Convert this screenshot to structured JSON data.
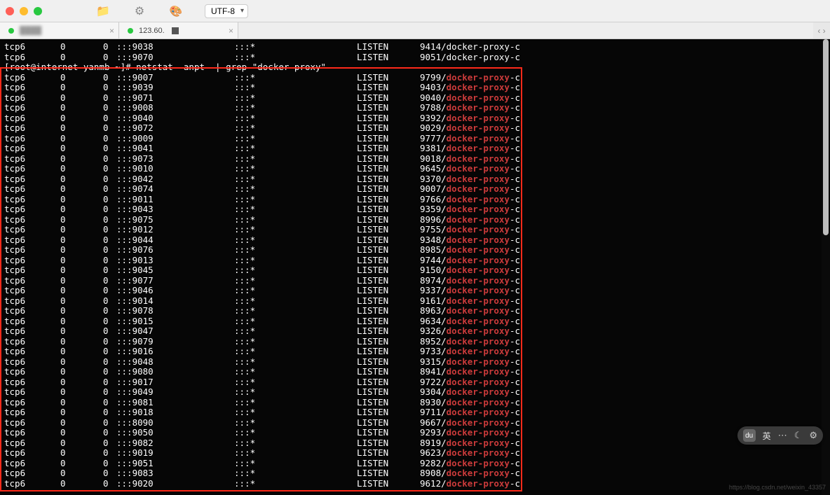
{
  "titlebar": {
    "encoding": "UTF-8"
  },
  "tabs": [
    {
      "label": "",
      "active": true
    },
    {
      "label": "123.60.",
      "active": false
    }
  ],
  "tabexpand": "‹ ›",
  "prompt": {
    "user_host": "[root@internet-yanmb ~]#",
    "command": "netstat -anpt  | grep \"docker-proxy\""
  },
  "pre_rows": [
    {
      "proto": "tcp6",
      "recv": "0",
      "send": "0",
      "local": ":::9038",
      "foreign": ":::*",
      "state": "LISTEN",
      "pid": "9414",
      "proc": "docker-proxy",
      "suf": "-c"
    },
    {
      "proto": "tcp6",
      "recv": "0",
      "send": "0",
      "local": ":::9070",
      "foreign": ":::*",
      "state": "LISTEN",
      "pid": "9051",
      "proc": "docker-proxy",
      "suf": "-c"
    }
  ],
  "rows": [
    {
      "proto": "tcp6",
      "recv": "0",
      "send": "0",
      "local": ":::9007",
      "foreign": ":::*",
      "state": "LISTEN",
      "pid": "9799",
      "proc": "docker-proxy",
      "suf": "-c"
    },
    {
      "proto": "tcp6",
      "recv": "0",
      "send": "0",
      "local": ":::9039",
      "foreign": ":::*",
      "state": "LISTEN",
      "pid": "9403",
      "proc": "docker-proxy",
      "suf": "-c"
    },
    {
      "proto": "tcp6",
      "recv": "0",
      "send": "0",
      "local": ":::9071",
      "foreign": ":::*",
      "state": "LISTEN",
      "pid": "9040",
      "proc": "docker-proxy",
      "suf": "-c"
    },
    {
      "proto": "tcp6",
      "recv": "0",
      "send": "0",
      "local": ":::9008",
      "foreign": ":::*",
      "state": "LISTEN",
      "pid": "9788",
      "proc": "docker-proxy",
      "suf": "-c"
    },
    {
      "proto": "tcp6",
      "recv": "0",
      "send": "0",
      "local": ":::9040",
      "foreign": ":::*",
      "state": "LISTEN",
      "pid": "9392",
      "proc": "docker-proxy",
      "suf": "-c"
    },
    {
      "proto": "tcp6",
      "recv": "0",
      "send": "0",
      "local": ":::9072",
      "foreign": ":::*",
      "state": "LISTEN",
      "pid": "9029",
      "proc": "docker-proxy",
      "suf": "-c"
    },
    {
      "proto": "tcp6",
      "recv": "0",
      "send": "0",
      "local": ":::9009",
      "foreign": ":::*",
      "state": "LISTEN",
      "pid": "9777",
      "proc": "docker-proxy",
      "suf": "-c"
    },
    {
      "proto": "tcp6",
      "recv": "0",
      "send": "0",
      "local": ":::9041",
      "foreign": ":::*",
      "state": "LISTEN",
      "pid": "9381",
      "proc": "docker-proxy",
      "suf": "-c"
    },
    {
      "proto": "tcp6",
      "recv": "0",
      "send": "0",
      "local": ":::9073",
      "foreign": ":::*",
      "state": "LISTEN",
      "pid": "9018",
      "proc": "docker-proxy",
      "suf": "-c"
    },
    {
      "proto": "tcp6",
      "recv": "0",
      "send": "0",
      "local": ":::9010",
      "foreign": ":::*",
      "state": "LISTEN",
      "pid": "9645",
      "proc": "docker-proxy",
      "suf": "-c"
    },
    {
      "proto": "tcp6",
      "recv": "0",
      "send": "0",
      "local": ":::9042",
      "foreign": ":::*",
      "state": "LISTEN",
      "pid": "9370",
      "proc": "docker-proxy",
      "suf": "-c"
    },
    {
      "proto": "tcp6",
      "recv": "0",
      "send": "0",
      "local": ":::9074",
      "foreign": ":::*",
      "state": "LISTEN",
      "pid": "9007",
      "proc": "docker-proxy",
      "suf": "-c"
    },
    {
      "proto": "tcp6",
      "recv": "0",
      "send": "0",
      "local": ":::9011",
      "foreign": ":::*",
      "state": "LISTEN",
      "pid": "9766",
      "proc": "docker-proxy",
      "suf": "-c"
    },
    {
      "proto": "tcp6",
      "recv": "0",
      "send": "0",
      "local": ":::9043",
      "foreign": ":::*",
      "state": "LISTEN",
      "pid": "9359",
      "proc": "docker-proxy",
      "suf": "-c"
    },
    {
      "proto": "tcp6",
      "recv": "0",
      "send": "0",
      "local": ":::9075",
      "foreign": ":::*",
      "state": "LISTEN",
      "pid": "8996",
      "proc": "docker-proxy",
      "suf": "-c"
    },
    {
      "proto": "tcp6",
      "recv": "0",
      "send": "0",
      "local": ":::9012",
      "foreign": ":::*",
      "state": "LISTEN",
      "pid": "9755",
      "proc": "docker-proxy",
      "suf": "-c"
    },
    {
      "proto": "tcp6",
      "recv": "0",
      "send": "0",
      "local": ":::9044",
      "foreign": ":::*",
      "state": "LISTEN",
      "pid": "9348",
      "proc": "docker-proxy",
      "suf": "-c"
    },
    {
      "proto": "tcp6",
      "recv": "0",
      "send": "0",
      "local": ":::9076",
      "foreign": ":::*",
      "state": "LISTEN",
      "pid": "8985",
      "proc": "docker-proxy",
      "suf": "-c"
    },
    {
      "proto": "tcp6",
      "recv": "0",
      "send": "0",
      "local": ":::9013",
      "foreign": ":::*",
      "state": "LISTEN",
      "pid": "9744",
      "proc": "docker-proxy",
      "suf": "-c"
    },
    {
      "proto": "tcp6",
      "recv": "0",
      "send": "0",
      "local": ":::9045",
      "foreign": ":::*",
      "state": "LISTEN",
      "pid": "9150",
      "proc": "docker-proxy",
      "suf": "-c"
    },
    {
      "proto": "tcp6",
      "recv": "0",
      "send": "0",
      "local": ":::9077",
      "foreign": ":::*",
      "state": "LISTEN",
      "pid": "8974",
      "proc": "docker-proxy",
      "suf": "-c"
    },
    {
      "proto": "tcp6",
      "recv": "0",
      "send": "0",
      "local": ":::9046",
      "foreign": ":::*",
      "state": "LISTEN",
      "pid": "9337",
      "proc": "docker-proxy",
      "suf": "-c"
    },
    {
      "proto": "tcp6",
      "recv": "0",
      "send": "0",
      "local": ":::9014",
      "foreign": ":::*",
      "state": "LISTEN",
      "pid": "9161",
      "proc": "docker-proxy",
      "suf": "-c"
    },
    {
      "proto": "tcp6",
      "recv": "0",
      "send": "0",
      "local": ":::9078",
      "foreign": ":::*",
      "state": "LISTEN",
      "pid": "8963",
      "proc": "docker-proxy",
      "suf": "-c"
    },
    {
      "proto": "tcp6",
      "recv": "0",
      "send": "0",
      "local": ":::9015",
      "foreign": ":::*",
      "state": "LISTEN",
      "pid": "9634",
      "proc": "docker-proxy",
      "suf": "-c"
    },
    {
      "proto": "tcp6",
      "recv": "0",
      "send": "0",
      "local": ":::9047",
      "foreign": ":::*",
      "state": "LISTEN",
      "pid": "9326",
      "proc": "docker-proxy",
      "suf": "-c"
    },
    {
      "proto": "tcp6",
      "recv": "0",
      "send": "0",
      "local": ":::9079",
      "foreign": ":::*",
      "state": "LISTEN",
      "pid": "8952",
      "proc": "docker-proxy",
      "suf": "-c"
    },
    {
      "proto": "tcp6",
      "recv": "0",
      "send": "0",
      "local": ":::9016",
      "foreign": ":::*",
      "state": "LISTEN",
      "pid": "9733",
      "proc": "docker-proxy",
      "suf": "-c"
    },
    {
      "proto": "tcp6",
      "recv": "0",
      "send": "0",
      "local": ":::9048",
      "foreign": ":::*",
      "state": "LISTEN",
      "pid": "9315",
      "proc": "docker-proxy",
      "suf": "-c"
    },
    {
      "proto": "tcp6",
      "recv": "0",
      "send": "0",
      "local": ":::9080",
      "foreign": ":::*",
      "state": "LISTEN",
      "pid": "8941",
      "proc": "docker-proxy",
      "suf": "-c"
    },
    {
      "proto": "tcp6",
      "recv": "0",
      "send": "0",
      "local": ":::9017",
      "foreign": ":::*",
      "state": "LISTEN",
      "pid": "9722",
      "proc": "docker-proxy",
      "suf": "-c"
    },
    {
      "proto": "tcp6",
      "recv": "0",
      "send": "0",
      "local": ":::9049",
      "foreign": ":::*",
      "state": "LISTEN",
      "pid": "9304",
      "proc": "docker-proxy",
      "suf": "-c"
    },
    {
      "proto": "tcp6",
      "recv": "0",
      "send": "0",
      "local": ":::9081",
      "foreign": ":::*",
      "state": "LISTEN",
      "pid": "8930",
      "proc": "docker-proxy",
      "suf": "-c"
    },
    {
      "proto": "tcp6",
      "recv": "0",
      "send": "0",
      "local": ":::9018",
      "foreign": ":::*",
      "state": "LISTEN",
      "pid": "9711",
      "proc": "docker-proxy",
      "suf": "-c"
    },
    {
      "proto": "tcp6",
      "recv": "0",
      "send": "0",
      "local": ":::8090",
      "foreign": ":::*",
      "state": "LISTEN",
      "pid": "9667",
      "proc": "docker-proxy",
      "suf": "-c"
    },
    {
      "proto": "tcp6",
      "recv": "0",
      "send": "0",
      "local": ":::9050",
      "foreign": ":::*",
      "state": "LISTEN",
      "pid": "9293",
      "proc": "docker-proxy",
      "suf": "-c"
    },
    {
      "proto": "tcp6",
      "recv": "0",
      "send": "0",
      "local": ":::9082",
      "foreign": ":::*",
      "state": "LISTEN",
      "pid": "8919",
      "proc": "docker-proxy",
      "suf": "-c"
    },
    {
      "proto": "tcp6",
      "recv": "0",
      "send": "0",
      "local": ":::9019",
      "foreign": ":::*",
      "state": "LISTEN",
      "pid": "9623",
      "proc": "docker-proxy",
      "suf": "-c"
    },
    {
      "proto": "tcp6",
      "recv": "0",
      "send": "0",
      "local": ":::9051",
      "foreign": ":::*",
      "state": "LISTEN",
      "pid": "9282",
      "proc": "docker-proxy",
      "suf": "-c"
    },
    {
      "proto": "tcp6",
      "recv": "0",
      "send": "0",
      "local": ":::9083",
      "foreign": ":::*",
      "state": "LISTEN",
      "pid": "8908",
      "proc": "docker-proxy",
      "suf": "-c"
    },
    {
      "proto": "tcp6",
      "recv": "0",
      "send": "0",
      "local": ":::9020",
      "foreign": ":::*",
      "state": "LISTEN",
      "pid": "9612",
      "proc": "docker-proxy",
      "suf": "-c"
    }
  ],
  "status_pill": {
    "badge": "du",
    "lang": "英"
  },
  "watermark": "https://blog.csdn.net/weixin_43357"
}
